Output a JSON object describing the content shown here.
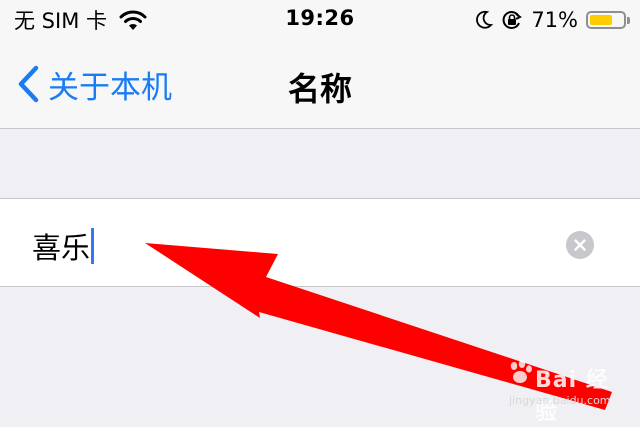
{
  "status_bar": {
    "carrier": "无 SIM 卡",
    "time": "19:26",
    "battery_percent": "71%",
    "battery_level": 0.71,
    "icons": [
      "wifi-icon",
      "moon-icon",
      "rotation-lock-icon",
      "battery-icon"
    ]
  },
  "nav": {
    "back_label": "关于本机",
    "title": "名称"
  },
  "name_field": {
    "value": "喜乐"
  },
  "watermark": {
    "main": "Bai  经验",
    "sub": "jingyan.baidu.com"
  },
  "colors": {
    "accent": "#1a7cf5",
    "caret": "#3578f6",
    "arrow": "#ff0000",
    "battery": "#ffcc00"
  }
}
